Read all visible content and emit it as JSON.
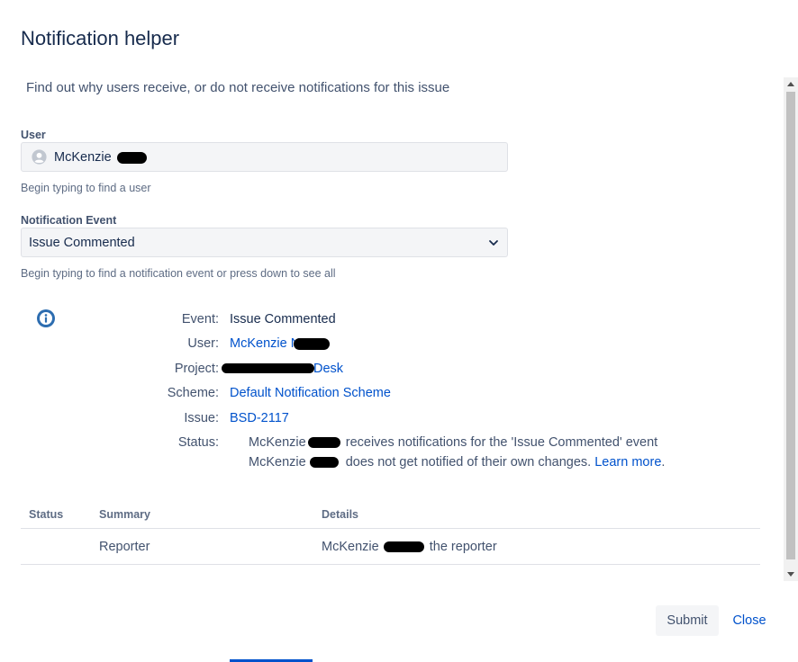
{
  "dialog": {
    "title": "Notification helper",
    "description": "Find out why users receive, or do not receive notifications for this issue"
  },
  "user_field": {
    "label": "User",
    "value": "McKenzie",
    "help": "Begin typing to find a user"
  },
  "event_field": {
    "label": "Notification Event",
    "value": "Issue Commented",
    "help": "Begin typing to find a notification event or press down to see all"
  },
  "result": {
    "event_key": "Event:",
    "event_value": "Issue Commented",
    "user_key": "User:",
    "user_value": "McKenzie N",
    "project_key": "Project:",
    "project_value": "Desk",
    "scheme_key": "Scheme:",
    "scheme_value": "Default Notification Scheme",
    "issue_key": "Issue:",
    "issue_value": "BSD-2117",
    "status_key": "Status:",
    "status_line1_name": "McKenzie",
    "status_line1_text": "receives notifications for the 'Issue Commented' event",
    "status_line2_name": "McKenzie",
    "status_line2_text": "does not get notified of their own changes.",
    "learn_more": "Learn more",
    "period": "."
  },
  "table": {
    "headers": [
      "Status",
      "Summary",
      "Details"
    ],
    "rows": [
      {
        "status": "",
        "summary": "Reporter",
        "details_name": "McKenzie",
        "details_text": "the reporter"
      }
    ]
  },
  "footer": {
    "submit_label": "Submit",
    "close_label": "Close"
  },
  "icons": {
    "user_avatar": "user-avatar-icon",
    "info": "info-icon",
    "chevron": "chevron-down-icon"
  }
}
